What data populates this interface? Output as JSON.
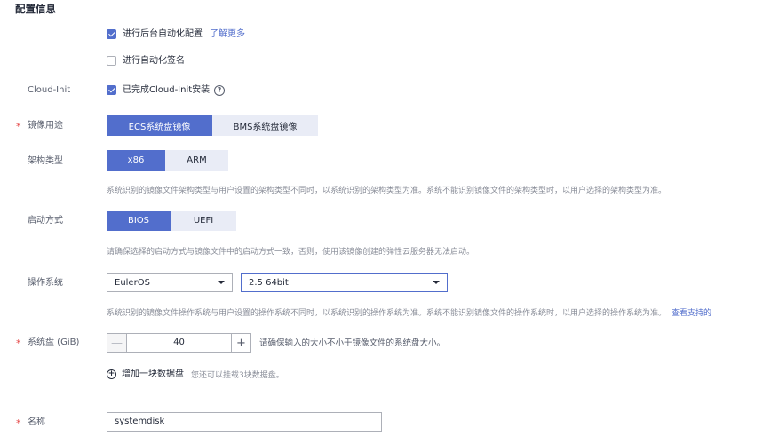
{
  "section_title": "配置信息",
  "auto_config": {
    "label": "进行后台自动化配置",
    "link": "了解更多",
    "checked": true
  },
  "auto_sign": {
    "label": "进行自动化签名",
    "checked": false
  },
  "cloud_init": {
    "field_label": "Cloud-Init",
    "label": "已完成Cloud-Init安装",
    "checked": true,
    "help_glyph": "?"
  },
  "image_usage": {
    "field_label": "镜像用途",
    "required": "*",
    "options": [
      "ECS系统盘镜像",
      "BMS系统盘镜像"
    ],
    "selected": "ECS系统盘镜像"
  },
  "arch": {
    "field_label": "架构类型",
    "options": [
      "x86",
      "ARM"
    ],
    "selected": "x86",
    "hint": "系统识别的镜像文件架构类型与用户设置的架构类型不同时，以系统识别的架构类型为准。系统不能识别镜像文件的架构类型时，以用户选择的架构类型为准。"
  },
  "boot": {
    "field_label": "启动方式",
    "options": [
      "BIOS",
      "UEFI"
    ],
    "selected": "BIOS",
    "hint": "请确保选择的启动方式与镜像文件中的启动方式一致，否则，使用该镜像创建的弹性云服务器无法启动。"
  },
  "os": {
    "field_label": "操作系统",
    "family": "EulerOS",
    "version": "2.5 64bit",
    "hint": "系统识别的镜像文件操作系统与用户设置的操作系统不同时，以系统识别的操作系统为准。系统不能识别镜像文件的操作系统时，以用户选择的操作系统为准。",
    "hint_link": "查看支持的"
  },
  "system_disk": {
    "field_label": "系统盘 (GiB)",
    "required": "*",
    "value": "40",
    "minus": "—",
    "plus": "+",
    "hint": "请确保输入的大小不小于镜像文件的系统盘大小。"
  },
  "data_disk": {
    "plus_glyph": "+",
    "add_label": "增加一块数据盘",
    "hint": "您还可以挂载3块数据盘。"
  },
  "name": {
    "field_label": "名称",
    "required": "*",
    "value": "systemdisk"
  },
  "colors": {
    "accent": "#526ecc",
    "required": "#e54545",
    "segment_bg": "#e9ecf6"
  }
}
